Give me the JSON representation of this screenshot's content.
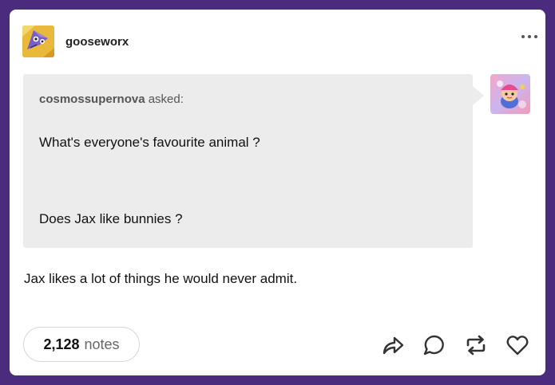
{
  "post": {
    "blog_name": "gooseworx",
    "ask": {
      "asker": "cosmossupernova",
      "asked_label": "asked:",
      "line1": "What's everyone's favourite animal ?",
      "line2": "Does Jax like bunnies ?"
    },
    "answer": "Jax likes a lot of things he would never admit.",
    "notes_count": "2,128",
    "notes_label": "notes"
  },
  "icons": {
    "more": "more-dots-icon",
    "share": "share-icon",
    "reply": "reply-icon",
    "reblog": "reblog-icon",
    "like": "heart-icon"
  },
  "colors": {
    "background": "#4b2b7d",
    "card": "#ffffff",
    "ask_bubble": "#ececec"
  }
}
